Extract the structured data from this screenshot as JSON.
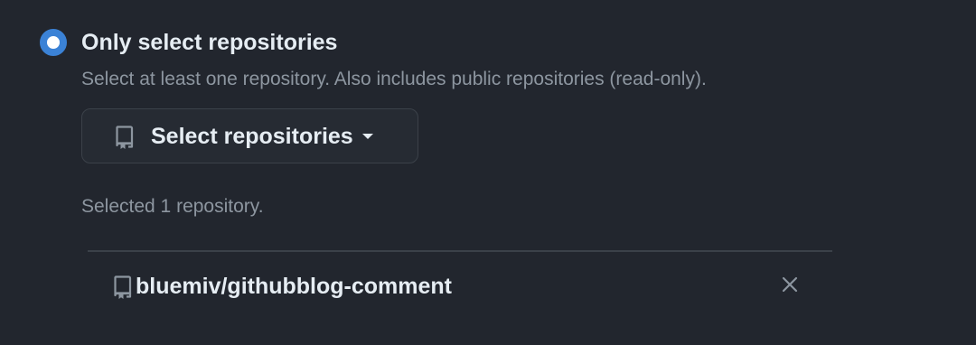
{
  "option": {
    "label": "Only select repositories",
    "description": "Select at least one repository. Also includes public repositories (read-only).",
    "selected": true
  },
  "select_button": {
    "label": "Select repositories",
    "icon": "repo-icon",
    "dropdown_icon": "caret-down-icon"
  },
  "selection": {
    "summary": "Selected 1 repository.",
    "repos": [
      {
        "owner": "bluemiv/",
        "name": "githubblog-comment",
        "icon": "repo-icon",
        "remove_icon": "close-icon"
      }
    ]
  },
  "colors": {
    "background": "#22262e",
    "accent": "#3b82d6",
    "text_primary": "#e6edf3",
    "text_muted": "#8d96a0",
    "border": "#3b4149"
  }
}
